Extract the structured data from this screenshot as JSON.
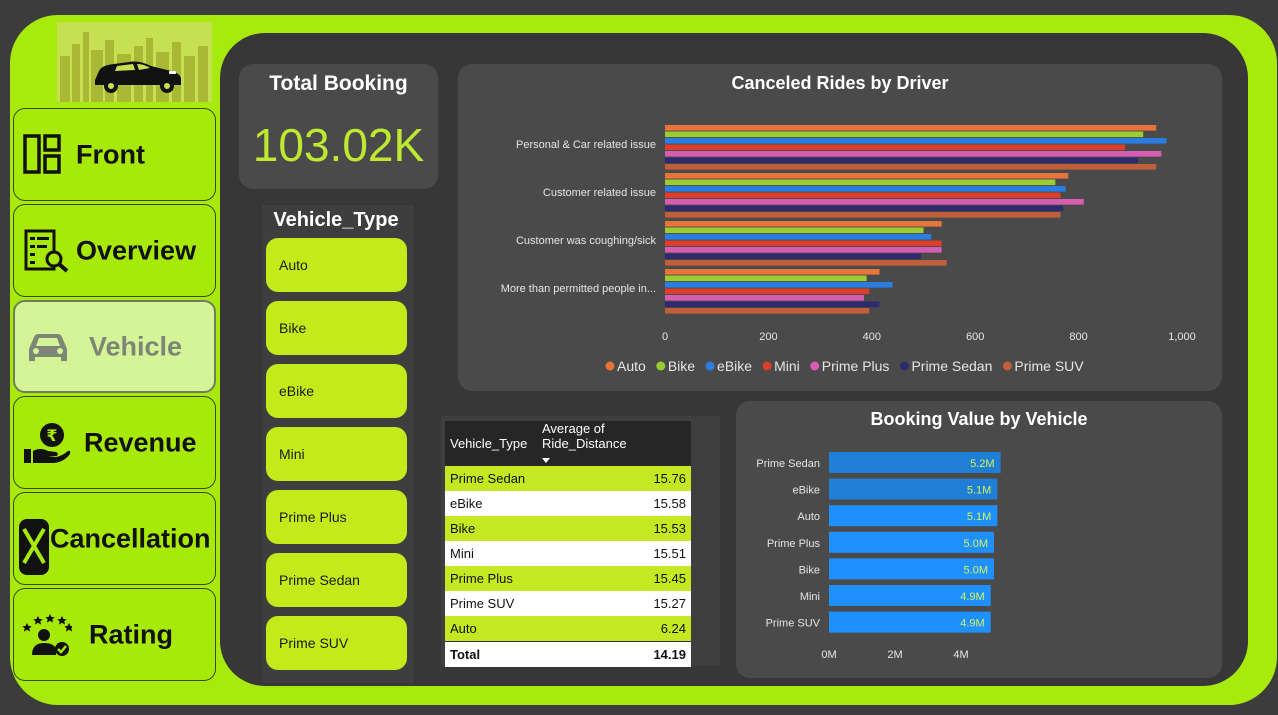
{
  "nav": [
    {
      "label": "Front",
      "icon": "dashboard-layout-icon"
    },
    {
      "label": "Overview",
      "icon": "document-search-icon"
    },
    {
      "label": "Vehicle",
      "icon": "car-icon",
      "active": true
    },
    {
      "label": "Revenue",
      "icon": "rupee-hand-icon"
    },
    {
      "label": "Cancellation",
      "icon": "cancel-x-icon"
    },
    {
      "label": "Rating",
      "icon": "stars-user-icon"
    }
  ],
  "kpi": {
    "title": "Total Booking",
    "value": "103.02K"
  },
  "slicer": {
    "title": "Vehicle_Type",
    "items": [
      "Auto",
      "Bike",
      "eBike",
      "Mini",
      "Prime Plus",
      "Prime Sedan",
      "Prime SUV"
    ]
  },
  "table": {
    "headers": [
      "Vehicle_Type",
      "Average of Ride_Distance"
    ],
    "rows": [
      [
        "Prime Sedan",
        "15.76"
      ],
      [
        "eBike",
        "15.58"
      ],
      [
        "Bike",
        "15.53"
      ],
      [
        "Mini",
        "15.51"
      ],
      [
        "Prime Plus",
        "15.45"
      ],
      [
        "Prime SUV",
        "15.27"
      ],
      [
        "Auto",
        "6.24"
      ]
    ],
    "total": [
      "Total",
      "14.19"
    ]
  },
  "colors": {
    "accent": "#a9ea0e",
    "panel": "#373737",
    "card": "#4a4a4a",
    "kpi_value": "#bfe930",
    "booking_bar": "#1e90ff"
  },
  "chart_data": [
    {
      "type": "bar",
      "orientation": "horizontal",
      "title": "Canceled Rides by Driver",
      "categories": [
        "Personal & Car related issue",
        "Customer related issue",
        "Customer was coughing/sick",
        "More than permitted people in..."
      ],
      "xlim": [
        0,
        1000
      ],
      "xticks": [
        "0",
        "200",
        "400",
        "600",
        "800",
        "1,000"
      ],
      "legend_position": "bottom",
      "series": [
        {
          "name": "Auto",
          "color": "#e8743b",
          "values": [
            950,
            780,
            535,
            415
          ]
        },
        {
          "name": "Bike",
          "color": "#9acd32",
          "values": [
            925,
            755,
            500,
            390
          ]
        },
        {
          "name": "eBike",
          "color": "#2a7de1",
          "values": [
            970,
            775,
            515,
            440
          ]
        },
        {
          "name": "Mini",
          "color": "#d9412c",
          "values": [
            890,
            765,
            535,
            395
          ]
        },
        {
          "name": "Prime Plus",
          "color": "#d65db1",
          "values": [
            960,
            810,
            535,
            385
          ]
        },
        {
          "name": "Prime Sedan",
          "color": "#2d2a6e",
          "values": [
            915,
            770,
            495,
            415
          ]
        },
        {
          "name": "Prime SUV",
          "color": "#c0603a",
          "values": [
            950,
            765,
            545,
            395
          ]
        }
      ]
    },
    {
      "type": "bar",
      "orientation": "horizontal",
      "title": "Booking Value by Vehicle",
      "categories": [
        "Prime Sedan",
        "eBike",
        "Auto",
        "Prime Plus",
        "Bike",
        "Mini",
        "Prime SUV"
      ],
      "values": [
        5.2,
        5.1,
        5.1,
        5.0,
        5.0,
        4.9,
        4.9
      ],
      "data_labels": [
        "5.2M",
        "5.1M",
        "5.1M",
        "5.0M",
        "5.0M",
        "4.9M",
        "4.9M"
      ],
      "xlim": [
        0,
        5.8
      ],
      "xticks": [
        "0M",
        "2M",
        "4M"
      ]
    }
  ]
}
